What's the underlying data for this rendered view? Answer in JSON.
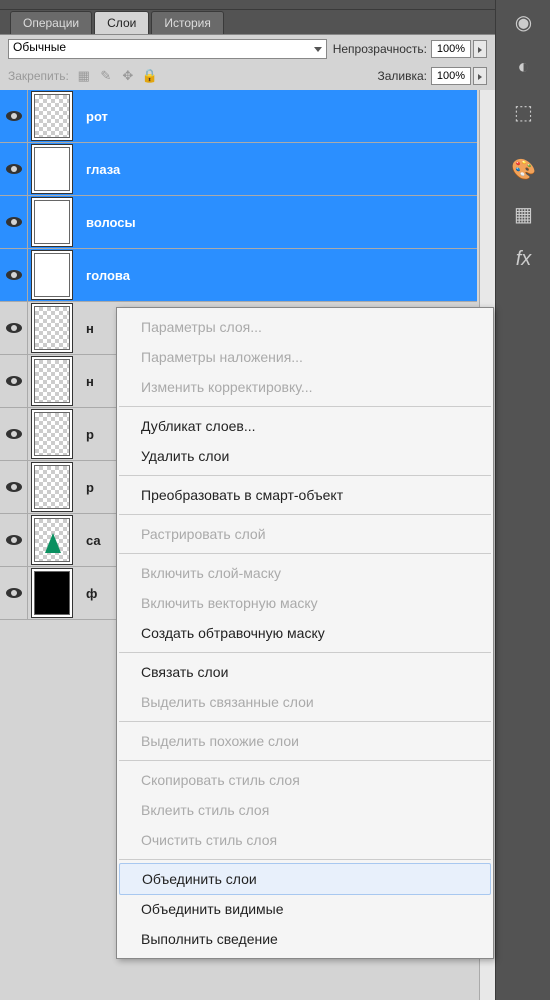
{
  "tabs": {
    "operations": "Операции",
    "layers": "Слои",
    "history": "История"
  },
  "options": {
    "blend_mode": "Обычные",
    "opacity_label": "Непрозрачность:",
    "opacity_value": "100%",
    "lock_label": "Закрепить:",
    "fill_label": "Заливка:",
    "fill_value": "100%"
  },
  "layers": [
    {
      "name": "рот",
      "selected": true,
      "thumb": "checker"
    },
    {
      "name": "глаза",
      "selected": true,
      "thumb": "white"
    },
    {
      "name": "волосы",
      "selected": true,
      "thumb": "white"
    },
    {
      "name": "голова",
      "selected": true,
      "thumb": "white"
    },
    {
      "name": "н",
      "selected": false,
      "thumb": "checker"
    },
    {
      "name": "н",
      "selected": false,
      "thumb": "checker"
    },
    {
      "name": "р",
      "selected": false,
      "thumb": "checker"
    },
    {
      "name": "р",
      "selected": false,
      "thumb": "checker"
    },
    {
      "name": "са",
      "selected": false,
      "thumb": "tree"
    },
    {
      "name": "ф",
      "selected": false,
      "thumb": "black"
    }
  ],
  "context_menu": [
    {
      "label": "Параметры слоя...",
      "disabled": true
    },
    {
      "label": "Параметры наложения...",
      "disabled": true
    },
    {
      "label": "Изменить корректировку...",
      "disabled": true
    },
    {
      "sep": true
    },
    {
      "label": "Дубликат слоев...",
      "disabled": false
    },
    {
      "label": "Удалить слои",
      "disabled": false
    },
    {
      "sep": true
    },
    {
      "label": "Преобразовать в смарт-объект",
      "disabled": false
    },
    {
      "sep": true
    },
    {
      "label": "Растрировать слой",
      "disabled": true
    },
    {
      "sep": true
    },
    {
      "label": "Включить слой-маску",
      "disabled": true
    },
    {
      "label": "Включить векторную маску",
      "disabled": true
    },
    {
      "label": "Создать обтравочную маску",
      "disabled": false
    },
    {
      "sep": true
    },
    {
      "label": "Связать слои",
      "disabled": false
    },
    {
      "label": "Выделить связанные слои",
      "disabled": true
    },
    {
      "sep": true
    },
    {
      "label": "Выделить похожие слои",
      "disabled": true
    },
    {
      "sep": true
    },
    {
      "label": "Скопировать стиль слоя",
      "disabled": true
    },
    {
      "label": "Вклеить стиль слоя",
      "disabled": true
    },
    {
      "label": "Очистить стиль слоя",
      "disabled": true
    },
    {
      "sep": true
    },
    {
      "label": "Объединить слои",
      "disabled": false,
      "highlighted": true
    },
    {
      "label": "Объединить видимые",
      "disabled": false
    },
    {
      "label": "Выполнить сведение",
      "disabled": false
    }
  ]
}
